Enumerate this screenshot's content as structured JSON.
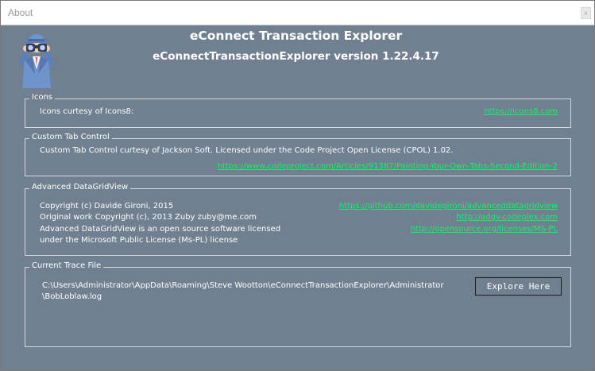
{
  "window": {
    "title": "About",
    "close_glyph": "x"
  },
  "header": {
    "app_name": "eConnect Transaction Explorer",
    "version_text": "eConnectTransactionExplorer version 1.22.4.17",
    "logo_icon": "spy-binoculars-icon"
  },
  "icons_group": {
    "legend": "Icons",
    "text": "Icons curtesy of Icons8:",
    "link": "https://icons8.com"
  },
  "tab_control_group": {
    "legend": "Custom Tab Control",
    "text": "Custom Tab Control curtesy of Jackson Soft. Licensed under the Code Project Open License (CPOL) 1.02.",
    "link": "https://www.codeproject.com/Articles/91387/Painting-Your-Own-Tabs-Second-Edition-2"
  },
  "datagrid_group": {
    "legend": "Advanced DataGridView",
    "line1": "Copyright (c) Davide Gironi, 2015",
    "line2": "Original work Copyright (c), 2013 Zuby zuby@me.com",
    "line3": "Advanced DataGridView is an open source software licensed",
    "line4": "under the Microsoft Public License (Ms-PL) license",
    "link1": "https://github.com/davidegironi/advanceddatagridview",
    "link2": "http://adgv.codeplex.com",
    "link3": "http://opensource.org/licenses/MS-PL"
  },
  "trace_group": {
    "legend": "Current Trace File",
    "path_line1": "C:\\Users\\Administrator\\AppData\\Roaming\\Steve Wootton\\eConnectTransactionExplorer\\Administrator",
    "path_line2": "\\BobLoblaw.log",
    "explore_button": "Explore Here"
  },
  "colors": {
    "background": "#708090",
    "link": "#12f06a",
    "text": "#ffffff"
  }
}
